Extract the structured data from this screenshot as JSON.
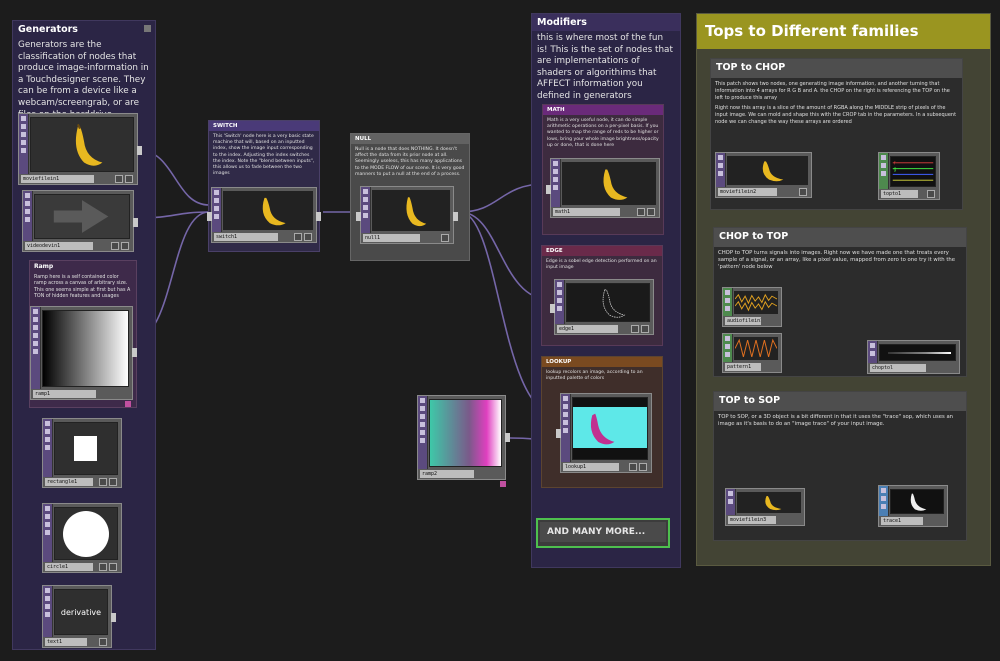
{
  "generators": {
    "title": "Generators",
    "body": "Generators are the classification of nodes that produce image-information in a Touchdesigner scene. They can be from a device like a webcam/screengrab, or are files on the harddrive"
  },
  "ramp_note": {
    "title": "Ramp",
    "body": "Ramp here is a self contained color ramp across a canvas of arbitrary size. This one seems simple at first but has A TON of hidden features and usages"
  },
  "switch_note": {
    "title": "SWITCH",
    "body": "This 'Switch' node here is a very basic state machine that will, based on an inputted index, show the image input corresponding to the index. Adjusting the index switches the index. Note the \"blend between inputs\", this allows us to fade between the two images"
  },
  "null_note": {
    "title": "NULL",
    "body": "Null is a node that does NOTHING. It doesn't affect the data from its prior node at all. Seemingly useless, this has many applications to the MODE FLOW of our scene. It is very good manners to put a null at the end of a process."
  },
  "modifiers": {
    "title": "Modifiers",
    "body": "this is where most of the fun is! This is the set of nodes that are implementations of shaders or algorithims that AFFECT information you defined in generators",
    "more_button": "AND MANY MORE..."
  },
  "math_note": {
    "title": "MATH",
    "body": "Math is a very useful node, it can do simple arithmetic operations on a per-pixel basis. If you wanted to map the range of reds to be higher or lows, bring your whole image brightness/opacity up or done, that is done here"
  },
  "edge_note": {
    "title": "EDGE",
    "body": "Edge is a sobel edge detection performed on an input image"
  },
  "lookup_note": {
    "title": "LOOKUP",
    "body": "lookup recolors an image, according to an inputted palette of colors"
  },
  "families": {
    "title": "Tops to Different families",
    "top_to_chop": {
      "title": "TOP to CHOP",
      "body1": "This patch shows two nodes, one generating image information, and another turning that information into 4 arrays for R G B and A. the CHOP on the right is referencing the TOP on the left to produce this array",
      "body2": "Right now this array is a slice of the amount of RGBA along the MIDDLE strip of pixels of the input image. We can mold and shape this with the CROP tab in the parameters. In a subsequent node we can change the way these arrays are ordered"
    },
    "chop_to_top": {
      "title": "CHOP to TOP",
      "body": "CHOP to TOP turns signals into images. Right now we have made one that treats every sample of a signal, or an array, like a pixel value, mapped from zero to one try it with the 'pattern' node below"
    },
    "top_to_sop": {
      "title": "TOP to SOP",
      "body": "TOP to SOP, or a 3D object is a bit different in that it uses the \"trace\" sop, which uses an image as it's basis to do an \"image trace\" of your input image."
    }
  },
  "nodes": {
    "moviefilein1": "moviefilein1",
    "videodevin1": "videodevin1",
    "ramp1": "ramp1",
    "rectangle1": "rectangle1",
    "circle1": "circle1",
    "text1": "text1",
    "text1_content": "derivative",
    "switch1": "switch1",
    "null1": "null1",
    "math1": "math1",
    "edge1": "edge1",
    "lookup1": "lookup1",
    "ramp2": "ramp2",
    "moviefilein2": "moviefilein2",
    "topto1": "topto1",
    "audiofilein1": "audiofilein1",
    "pattern1": "pattern1",
    "choptol": "choptol",
    "moviefilein3": "moviefilein3",
    "trace1": "trace1"
  },
  "colors": {
    "generators_bg": "#2b2545",
    "modifiers_bg": "#2b2545",
    "families_bg": "#434434",
    "families_title_bg": "#9a9520",
    "node_purple": "#5b4a7e",
    "chop_green": "#4e8a4e",
    "sop_blue": "#4b7fb4",
    "wire": "#7a6aaa",
    "more_button_border": "#4ec04e"
  }
}
